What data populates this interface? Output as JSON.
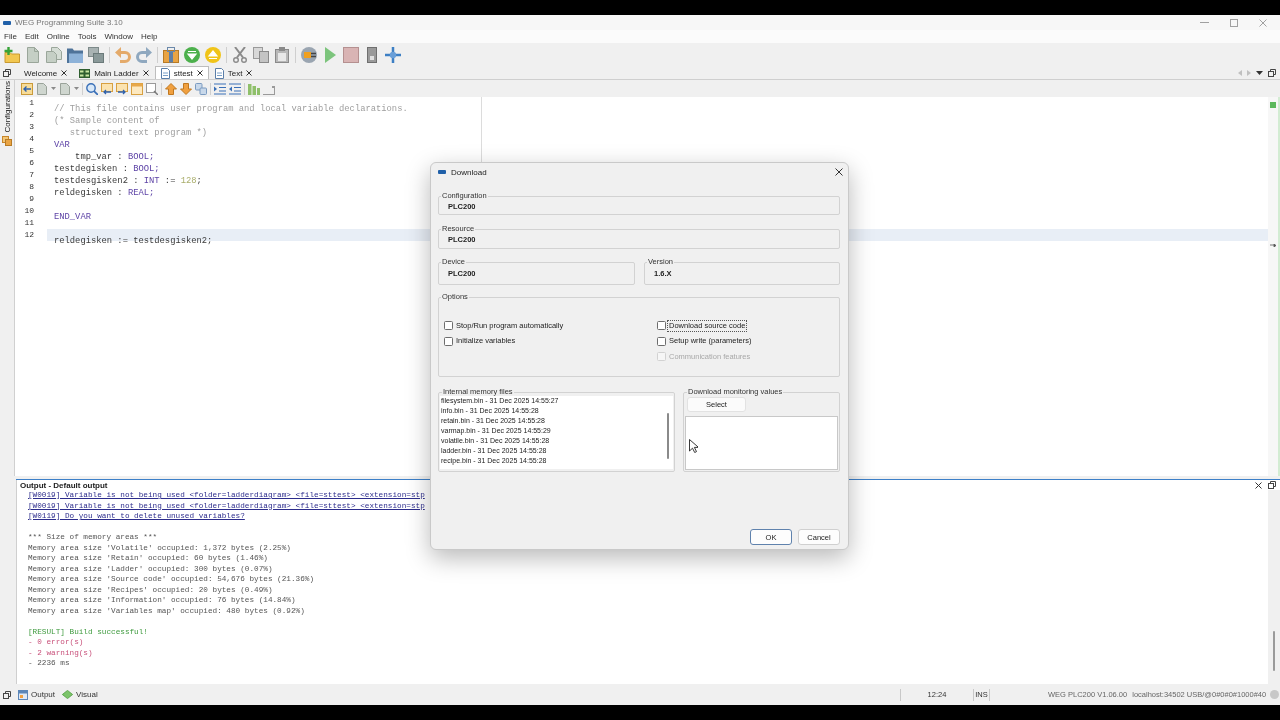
{
  "window": {
    "title": "WEG Programming Suite 3.10"
  },
  "menu": [
    "File",
    "Edit",
    "Online",
    "Tools",
    "Window",
    "Help"
  ],
  "tabs": [
    {
      "label": "Welcome",
      "kind": "plain",
      "selected": false
    },
    {
      "label": "Main Ladder",
      "kind": "ladder",
      "selected": false
    },
    {
      "label": "sttest",
      "kind": "document",
      "selected": true
    },
    {
      "label": "Text",
      "kind": "document",
      "selected": false
    }
  ],
  "sidebar": {
    "label": "Configurations"
  },
  "editor": {
    "lines": [
      {
        "number": "1",
        "highlighted": false,
        "tokens": [
          {
            "text": "// This file contains user program and local variable declarations.",
            "kind": "comment"
          }
        ]
      },
      {
        "number": "2",
        "highlighted": false,
        "tokens": [
          {
            "text": "(* Sample content of",
            "kind": "comment"
          }
        ]
      },
      {
        "number": "3",
        "highlighted": false,
        "tokens": [
          {
            "text": "   structured text program *)",
            "kind": "comment"
          }
        ]
      },
      {
        "number": "4",
        "highlighted": false,
        "tokens": [
          {
            "text": "VAR",
            "kind": "keyword"
          }
        ]
      },
      {
        "number": "5",
        "highlighted": false,
        "tokens": [
          {
            "text": "    tmp_var : ",
            "kind": "ident"
          },
          {
            "text": "BOOL;",
            "kind": "keyword"
          }
        ]
      },
      {
        "number": "6",
        "highlighted": false,
        "tokens": [
          {
            "text": "testdegisken : ",
            "kind": "ident"
          },
          {
            "text": "BOOL;",
            "kind": "keyword"
          }
        ]
      },
      {
        "number": "7",
        "highlighted": false,
        "tokens": [
          {
            "text": "testdesgisken2 : ",
            "kind": "ident"
          },
          {
            "text": "INT",
            "kind": "keyword"
          },
          {
            "text": " := ",
            "kind": "ident"
          },
          {
            "text": "128",
            "kind": "number"
          },
          {
            "text": ";",
            "kind": "ident"
          }
        ]
      },
      {
        "number": "8",
        "highlighted": false,
        "tokens": [
          {
            "text": "reldegisken : ",
            "kind": "ident"
          },
          {
            "text": "REAL;",
            "kind": "keyword"
          }
        ]
      },
      {
        "number": "9",
        "highlighted": false
      },
      {
        "number": "10",
        "highlighted": false,
        "tokens": [
          {
            "text": "END_VAR",
            "kind": "keyword"
          }
        ]
      },
      {
        "number": "11",
        "highlighted": false
      },
      {
        "number": "12",
        "highlighted": true,
        "tokens": [
          {
            "text": "reldegisken := testdesgisken2;",
            "kind": "ident"
          }
        ]
      }
    ]
  },
  "output": {
    "title": "Output - Default output",
    "groups": [
      {
        "lines": [
          {
            "text": "[W0019] Variable is not being used <folder=ladderdiagram> <file=sttest> <extension=stp",
            "kind": "warning"
          },
          {
            "text": "[W0019] Variable is not being used <folder=ladderdiagram> <file=sttest> <extension=stp",
            "kind": "warning"
          },
          {
            "text": "[W0119] Do you want to delete unused variables?",
            "kind": "warning"
          }
        ]
      },
      {
        "lines": [
          {
            "text": "*** Size of memory areas ***",
            "kind": "info"
          },
          {
            "text": "Memory area size 'Volatile' occupied: 1,372 bytes (2.25%)",
            "kind": "info"
          },
          {
            "text": "Memory area size 'Retain' occupied: 60 bytes (1.46%)",
            "kind": "info"
          },
          {
            "text": "Memory area size 'Ladder' occupied: 300 bytes (0.07%)",
            "kind": "info"
          },
          {
            "text": "Memory area size 'Source code' occupied: 54,676 bytes (21.36%)",
            "kind": "info"
          },
          {
            "text": "Memory area size 'Recipes' occupied: 20 bytes (0.49%)",
            "kind": "info"
          },
          {
            "text": "Memory area size 'Information' occupied: 76 bytes (14.84%)",
            "kind": "info"
          },
          {
            "text": "Memory area size 'Variables map' occupied: 480 bytes (0.92%)",
            "kind": "info"
          }
        ]
      },
      {
        "lines": [
          {
            "text": "[RESULT] Build successful!",
            "kind": "success"
          },
          {
            "text": "- 0 error(s)",
            "kind": "error"
          },
          {
            "text": "- 2 warning(s)",
            "kind": "error"
          },
          {
            "text": "- 2236 ms",
            "kind": "info"
          }
        ]
      }
    ]
  },
  "bottom_tabs": [
    {
      "label": "Output",
      "kind": "console"
    },
    {
      "label": "Visual",
      "kind": "visual"
    }
  ],
  "status_bar": {
    "position": "12:24",
    "mode": "INS",
    "device": "WEG PLC200 V1.06.00",
    "connection": "localhost:34502 USB/@0#0#0#1000#40"
  },
  "dialog": {
    "title": "Download",
    "configuration": {
      "label": "Configuration",
      "value": "PLC200"
    },
    "resource": {
      "label": "Resource",
      "value": "PLC200"
    },
    "device": {
      "label": "Device",
      "value": "PLC200"
    },
    "version": {
      "label": "Version",
      "value": "1.6.X"
    },
    "options": {
      "label": "Options",
      "columns": [
        {
          "items": [
            {
              "label": "Stop/Run program automatically",
              "checked": false,
              "disabled": false,
              "focused": false
            },
            {
              "label": "Initialize variables",
              "checked": false,
              "disabled": false,
              "focused": false
            }
          ]
        },
        {
          "items": [
            {
              "label": "Download source code",
              "checked": false,
              "disabled": false,
              "focused": true
            },
            {
              "label": "Setup write (parameters)",
              "checked": false,
              "disabled": false,
              "focused": false
            },
            {
              "label": "Communication features",
              "checked": false,
              "disabled": true,
              "focused": false
            }
          ]
        }
      ]
    },
    "memory_files": {
      "label": "Internal memory files",
      "items": [
        "filesystem.bin - 31 Dec 2025 14:55:27",
        "info.bin - 31 Dec 2025 14:55:28",
        "retain.bin - 31 Dec 2025 14:55:28",
        "varmap.bin - 31 Dec 2025 14:55:29",
        "volatile.bin - 31 Dec 2025 14:55:28",
        "ladder.bin - 31 Dec 2025 14:55:28",
        "recipe.bin - 31 Dec 2025 14:55:28"
      ]
    },
    "monitoring": {
      "label": "Download monitoring values",
      "button": "Select"
    },
    "buttons": [
      {
        "label": "OK",
        "default": true
      },
      {
        "label": "Cancel",
        "default": false
      }
    ]
  }
}
